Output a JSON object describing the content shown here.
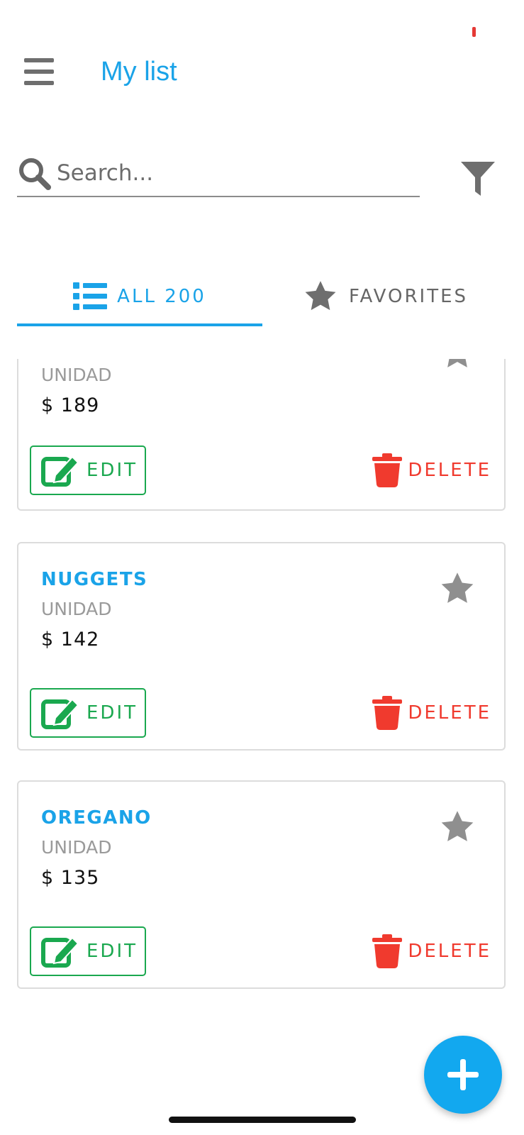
{
  "header": {
    "title": "My list"
  },
  "search": {
    "placeholder": "Search..."
  },
  "tabs": [
    {
      "label": "ALL 200",
      "icon": "list-icon",
      "active": true
    },
    {
      "label": "FAVORITES",
      "icon": "star-icon",
      "active": false
    }
  ],
  "products": [
    {
      "name": "",
      "unit": "UNIDAD",
      "price": "$ 189"
    },
    {
      "name": "NUGGETS",
      "unit": "UNIDAD",
      "price": "$ 142"
    },
    {
      "name": "OREGANO",
      "unit": "UNIDAD",
      "price": "$ 135"
    }
  ],
  "actions": {
    "edit_label": "EDIT",
    "delete_label": "DELETE"
  },
  "colors": {
    "accent": "#1aa3e8",
    "edit": "#1aa84f",
    "delete": "#f03a2e",
    "fab": "#12a8ef"
  }
}
